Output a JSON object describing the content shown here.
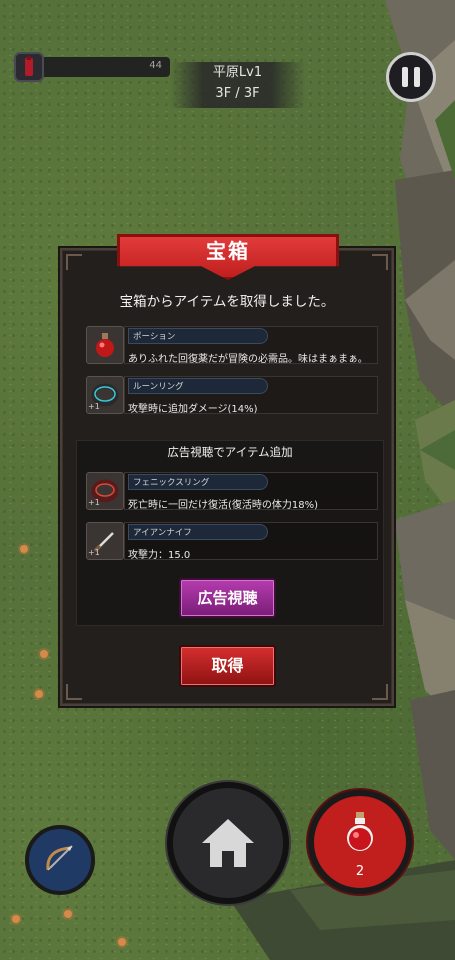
{
  "hud": {
    "hp_value": "44",
    "stage_name": "平原Lv1",
    "floor": "3F / 3F",
    "pause_icon": "pause-icon"
  },
  "modal": {
    "title": "宝箱",
    "message": "宝箱からアイテムを取得しました。",
    "items": [
      {
        "name": "ポーション",
        "desc": "ありふれた回復薬だが冒険の必需品。味はまぁまぁ。",
        "icon": "potion-icon",
        "plus": ""
      },
      {
        "name": "ルーンリング",
        "desc": "攻撃時に追加ダメージ(14%)",
        "icon": "ring-icon",
        "plus": "+1"
      }
    ],
    "ad_section": {
      "title": "広告視聴でアイテム追加",
      "items": [
        {
          "name": "フェニックスリング",
          "desc": "死亡時に一回だけ復活(復活時の体力18%)",
          "icon": "phoenix-ring-icon",
          "plus": "+1"
        },
        {
          "name": "アイアンナイフ",
          "desc": "攻撃力：15.0",
          "icon": "knife-icon",
          "plus": "+1"
        }
      ],
      "button_label": "広告視聴"
    },
    "get_button_label": "取得"
  },
  "controls": {
    "potion_count": "2",
    "bow_icon": "bow-icon",
    "home_icon": "home-icon",
    "potion_icon": "potion-icon"
  },
  "colors": {
    "ribbon_red": "#d32a2a",
    "ad_button_purple": "#9a2a94",
    "get_button_red": "#b51f1f",
    "grass_green": "#56713a"
  }
}
